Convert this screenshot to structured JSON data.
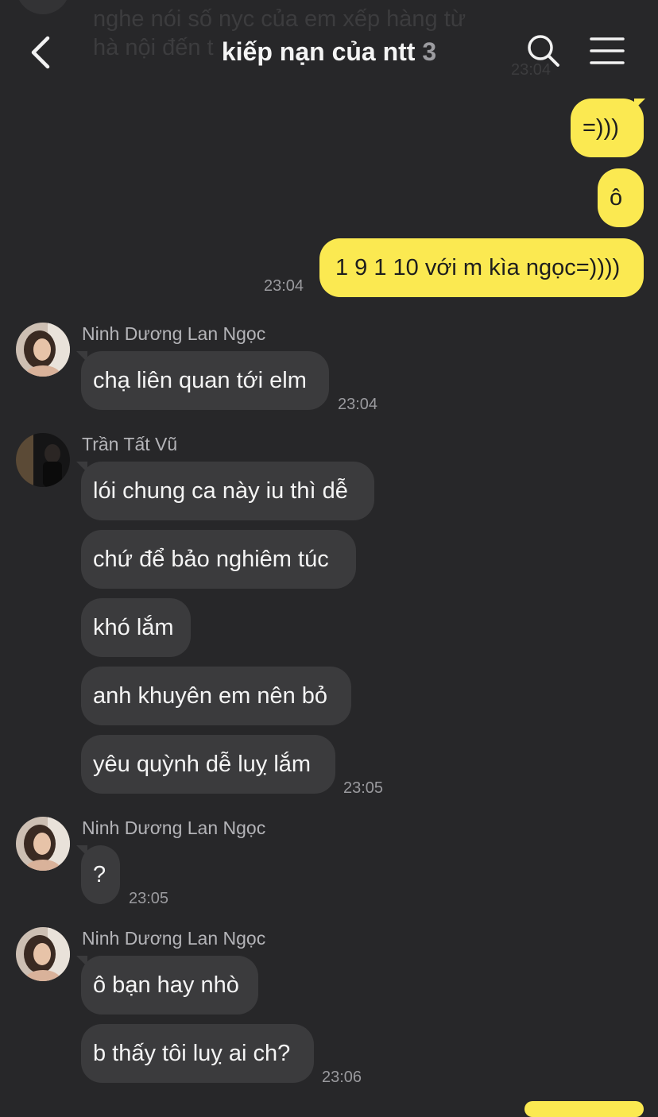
{
  "header": {
    "title": "kiếp nạn của ntt",
    "member_count": "3",
    "back_icon": "chevron-left-icon",
    "search_icon": "search-icon",
    "menu_icon": "hamburger-menu-icon"
  },
  "ghost": {
    "line1": "nghe nói số nyc của em xếp hàng từ",
    "line2": "hà nội đến t",
    "time": "23:04"
  },
  "colors": {
    "background": "#272729",
    "my_bubble": "#fbe951",
    "their_bubble": "#3b3b3d"
  },
  "messages": {
    "m1": "=)))",
    "m2": "ô",
    "m3": "1 9 1 10 với m kìa ngọc=))))",
    "m3_time": "23:04",
    "g1_sender": "Ninh Dương Lan Ngọc",
    "m4": "chạ liên quan tới elm",
    "m4_time": "23:04",
    "g2_sender": "Trần Tất Vũ",
    "m5": "lói chung ca này iu thì dễ",
    "m6": "chứ để bảo nghiêm túc",
    "m7": "khó lắm",
    "m8": "anh khuyên em nên bỏ",
    "m9": "yêu quỳnh dễ luỵ lắm",
    "m9_time": "23:05",
    "g3_sender": "Ninh Dương Lan Ngọc",
    "m10": "?",
    "m10_time": "23:05",
    "g4_sender": "Ninh Dương Lan Ngọc",
    "m11": "ô bạn hay nhò",
    "m12": "b thấy tôi luỵ ai ch?",
    "m12_time": "23:06"
  }
}
